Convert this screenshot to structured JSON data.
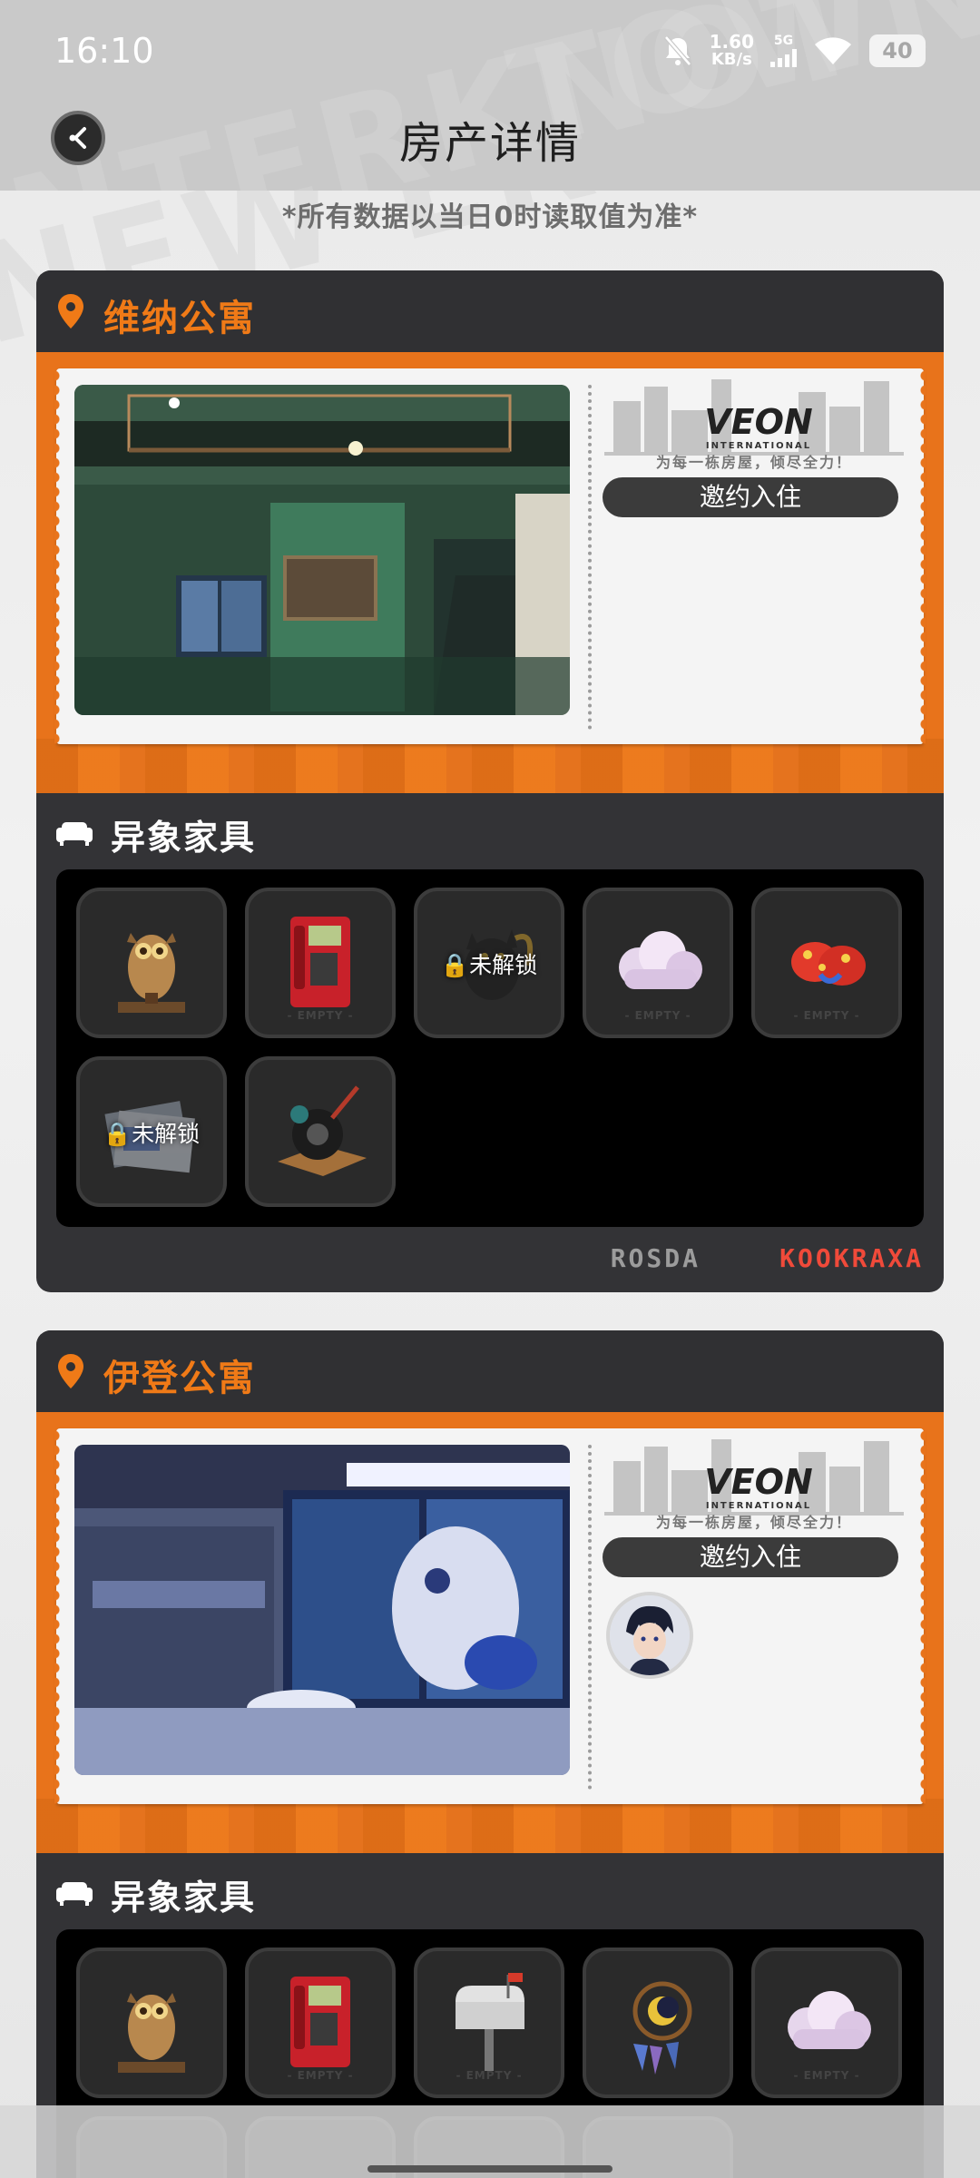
{
  "status_bar": {
    "time": "16:10",
    "net_speed_value": "1.60",
    "net_speed_unit": "KB/s",
    "network_type": "5G",
    "battery": "40"
  },
  "header": {
    "title": "房产详情",
    "notice": "*所有数据以当日0时读取值为准*"
  },
  "colors": {
    "accent": "#e8731b",
    "card_bg": "#333336",
    "title_orange": "#f07a17"
  },
  "properties": [
    {
      "name": "维纳公寓",
      "logo_slogan": "为每一栋房屋，倾尽全力！",
      "invite_label": "邀约入住",
      "furniture_title": "异象家具",
      "furniture": [
        {
          "icon": "owl-statue-icon",
          "locked": false
        },
        {
          "icon": "red-phone-booth-icon",
          "locked": false
        },
        {
          "icon": "black-cat-icon",
          "locked": true,
          "lock_label": "未解锁"
        },
        {
          "icon": "pink-cloud-icon",
          "locked": false
        },
        {
          "icon": "red-mushroom-icon",
          "locked": false
        },
        {
          "icon": "poster-stack-icon",
          "locked": true,
          "lock_label": "未解锁"
        },
        {
          "icon": "tire-stand-icon",
          "locked": false
        }
      ],
      "brand_left": "ROSDA",
      "brand_right": "KOOKRAXA"
    },
    {
      "name": "伊登公寓",
      "logo_slogan": "为每一栋房屋，倾尽全力！",
      "invite_label": "邀约入住",
      "furniture_title": "异象家具",
      "furniture": [
        {
          "icon": "owl-statue-icon",
          "locked": false
        },
        {
          "icon": "red-phone-booth-icon",
          "locked": false
        },
        {
          "icon": "mailbox-icon",
          "locked": false
        },
        {
          "icon": "dreamcatcher-icon",
          "locked": false
        },
        {
          "icon": "pink-cloud-icon",
          "locked": false
        }
      ]
    }
  ]
}
